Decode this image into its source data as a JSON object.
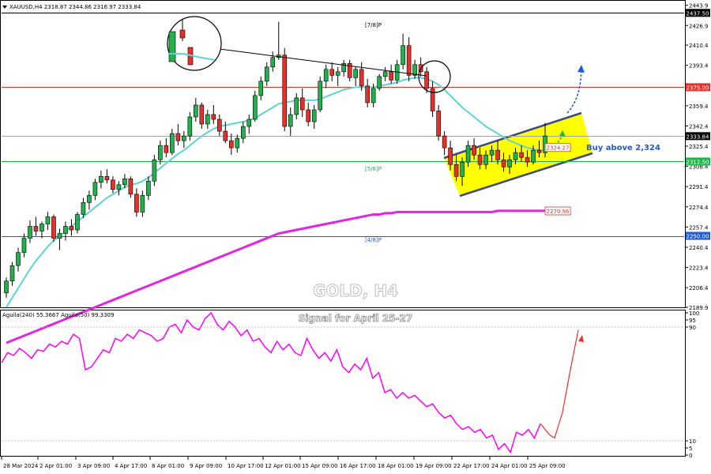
{
  "header": {
    "symbol_info": "XAUUSD,H4  2318.87 2344.86 2316.97 2333.84"
  },
  "indicator_header": "Aguila(240) 55.3667  Aguila(50) 99.3309",
  "watermark": {
    "title": "GOLD, H4",
    "subtitle": "Signal for April 25-27"
  },
  "annotations": {
    "buy_text": "Buy above 2,324",
    "level_7_8": "[7/8]P",
    "level_5_8": "[5/8]P",
    "level_4_8": "[4/8]P"
  },
  "colors": {
    "bull": "#22b14c",
    "bear": "#e8302a",
    "ma_fast": "#5fd3d3",
    "ma_slow": "#e026e0",
    "channel": "#ffff00",
    "buy_text": "#1e5bd7",
    "oscillator": "#ff00ff",
    "projection_red": "#e8302a",
    "projection_green": "#22b14c",
    "projection_blue": "#1e5bd7"
  },
  "chart_data": [
    {
      "type": "candlestick",
      "panel": "price",
      "title": "XAUUSD,H4",
      "x_ticks": [
        "28 Mar 2024",
        "2 Apr 01:00",
        "3 Apr 09:00",
        "4 Apr 17:00",
        "8 Apr 01:00",
        "9 Apr 09:00",
        "10 Apr 17:00",
        "12 Apr 01:00",
        "15 Apr 09:00",
        "16 Apr 17:00",
        "18 Apr 01:00",
        "19 Apr 09:00",
        "22 Apr 17:00",
        "24 Apr 01:00",
        "25 Apr 09:00"
      ],
      "y_ticks": [
        2443.9,
        2426.9,
        2410.4,
        2393.4,
        2376.4,
        2359.4,
        2342.4,
        2325.4,
        2308.4,
        2291.4,
        2274.4,
        2257.4,
        2240.4,
        2223.4,
        2206.4,
        2189.9
      ],
      "ylim": [
        2189.9,
        2447
      ],
      "price_labels": [
        {
          "text": "2437.50",
          "value": 2437.5,
          "color": "#000000"
        },
        {
          "text": "2375.00",
          "value": 2375.0,
          "color": "#e8302a"
        },
        {
          "text": "2333.84",
          "value": 2333.84,
          "color": "#000000"
        },
        {
          "text": "2312.50",
          "value": 2312.5,
          "color": "#22b14c"
        },
        {
          "text": "2250.00",
          "value": 2250.0,
          "color": "#1e5bd7"
        }
      ],
      "horizontal_lines": [
        {
          "name": "[7/8]P",
          "value": 2437.5,
          "color": "#000000"
        },
        {
          "name": "resistance",
          "value": 2375.0,
          "color": "#e8302a"
        },
        {
          "name": "current",
          "value": 2333.84,
          "color": "#a0a0a0"
        },
        {
          "name": "[5/8]P",
          "value": 2312.5,
          "color": "#22b14c"
        },
        {
          "name": "[4/8]P",
          "value": 2250.0,
          "color": "#1e5bd7"
        }
      ],
      "inline_labels": [
        {
          "text": "2324.27",
          "value": 2324.27,
          "color": "#e8302a"
        },
        {
          "text": "2270.96",
          "value": 2270.96,
          "color": "#e8302a"
        }
      ],
      "ohlc": [
        [
          2202,
          2215,
          2198,
          2212
        ],
        [
          2212,
          2228,
          2208,
          2225
        ],
        [
          2225,
          2240,
          2220,
          2236
        ],
        [
          2236,
          2252,
          2232,
          2248
        ],
        [
          2248,
          2263,
          2244,
          2258
        ],
        [
          2258,
          2266,
          2250,
          2254
        ],
        [
          2254,
          2262,
          2248,
          2260
        ],
        [
          2260,
          2270,
          2255,
          2266
        ],
        [
          2266,
          2268,
          2245,
          2248
        ],
        [
          2248,
          2256,
          2238,
          2252
        ],
        [
          2252,
          2262,
          2246,
          2258
        ],
        [
          2258,
          2264,
          2250,
          2255
        ],
        [
          2255,
          2270,
          2252,
          2268
        ],
        [
          2268,
          2282,
          2265,
          2278
        ],
        [
          2278,
          2288,
          2272,
          2284
        ],
        [
          2284,
          2298,
          2280,
          2295
        ],
        [
          2295,
          2305,
          2290,
          2300
        ],
        [
          2300,
          2306,
          2294,
          2297
        ],
        [
          2297,
          2300,
          2286,
          2289
        ],
        [
          2289,
          2296,
          2284,
          2293
        ],
        [
          2293,
          2302,
          2290,
          2298
        ],
        [
          2298,
          2300,
          2282,
          2285
        ],
        [
          2285,
          2290,
          2266,
          2270
        ],
        [
          2270,
          2288,
          2266,
          2284
        ],
        [
          2284,
          2300,
          2280,
          2296
        ],
        [
          2296,
          2318,
          2292,
          2314
        ],
        [
          2314,
          2330,
          2310,
          2326
        ],
        [
          2326,
          2332,
          2316,
          2320
        ],
        [
          2320,
          2340,
          2318,
          2336
        ],
        [
          2336,
          2344,
          2326,
          2330
        ],
        [
          2330,
          2338,
          2324,
          2334
        ],
        [
          2334,
          2354,
          2330,
          2350
        ],
        [
          2350,
          2366,
          2346,
          2360
        ],
        [
          2360,
          2362,
          2340,
          2344
        ],
        [
          2344,
          2356,
          2340,
          2352
        ],
        [
          2352,
          2360,
          2344,
          2348
        ],
        [
          2348,
          2352,
          2334,
          2338
        ],
        [
          2338,
          2346,
          2328,
          2330
        ],
        [
          2330,
          2336,
          2318,
          2324
        ],
        [
          2324,
          2335,
          2320,
          2332
        ],
        [
          2332,
          2346,
          2328,
          2342
        ],
        [
          2342,
          2352,
          2336,
          2348
        ],
        [
          2348,
          2372,
          2346,
          2368
        ],
        [
          2368,
          2384,
          2364,
          2380
        ],
        [
          2380,
          2396,
          2376,
          2392
        ],
        [
          2392,
          2405,
          2388,
          2400
        ],
        [
          2400,
          2430,
          2398,
          2402
        ],
        [
          2402,
          2408,
          2338,
          2342
        ],
        [
          2342,
          2358,
          2334,
          2352
        ],
        [
          2352,
          2370,
          2348,
          2366
        ],
        [
          2366,
          2374,
          2350,
          2356
        ],
        [
          2356,
          2362,
          2342,
          2346
        ],
        [
          2346,
          2360,
          2340,
          2356
        ],
        [
          2356,
          2384,
          2354,
          2380
        ],
        [
          2380,
          2394,
          2374,
          2390
        ],
        [
          2390,
          2396,
          2380,
          2385
        ],
        [
          2385,
          2392,
          2376,
          2388
        ],
        [
          2388,
          2398,
          2384,
          2395
        ],
        [
          2395,
          2398,
          2380,
          2383
        ],
        [
          2383,
          2392,
          2376,
          2390
        ],
        [
          2390,
          2396,
          2372,
          2376
        ],
        [
          2376,
          2382,
          2358,
          2362
        ],
        [
          2362,
          2378,
          2358,
          2374
        ],
        [
          2374,
          2386,
          2372,
          2384
        ],
        [
          2384,
          2392,
          2380,
          2388
        ],
        [
          2388,
          2394,
          2378,
          2381
        ],
        [
          2381,
          2398,
          2378,
          2394
        ],
        [
          2394,
          2420,
          2390,
          2410
        ],
        [
          2410,
          2417,
          2380,
          2385
        ],
        [
          2385,
          2398,
          2382,
          2394
        ],
        [
          2394,
          2400,
          2384,
          2388
        ],
        [
          2388,
          2392,
          2370,
          2374
        ],
        [
          2374,
          2380,
          2350,
          2355
        ],
        [
          2355,
          2360,
          2330,
          2334
        ],
        [
          2334,
          2338,
          2318,
          2324
        ],
        [
          2324,
          2330,
          2305,
          2310
        ],
        [
          2310,
          2318,
          2296,
          2300
        ],
        [
          2300,
          2316,
          2292,
          2312
        ],
        [
          2312,
          2330,
          2308,
          2326
        ],
        [
          2326,
          2332,
          2314,
          2318
        ],
        [
          2318,
          2324,
          2306,
          2310
        ],
        [
          2310,
          2322,
          2306,
          2318
        ],
        [
          2318,
          2326,
          2312,
          2322
        ],
        [
          2322,
          2330,
          2310,
          2314
        ],
        [
          2314,
          2320,
          2304,
          2308
        ],
        [
          2308,
          2318,
          2302,
          2314
        ],
        [
          2314,
          2324,
          2310,
          2320
        ],
        [
          2320,
          2326,
          2312,
          2316
        ],
        [
          2316,
          2322,
          2308,
          2312
        ],
        [
          2312,
          2326,
          2310,
          2322
        ],
        [
          2322,
          2330,
          2316,
          2320
        ],
        [
          2320,
          2345,
          2316,
          2334
        ]
      ],
      "series": [
        {
          "name": "ma_fast",
          "color": "#5fd3d3",
          "values": [
            2190,
            2198,
            2206,
            2214,
            2222,
            2229,
            2235,
            2241,
            2246,
            2250,
            2254,
            2258,
            2262,
            2266,
            2270,
            2274,
            2278,
            2282,
            2285,
            2288,
            2291,
            2293,
            2294,
            2296,
            2299,
            2303,
            2307,
            2311,
            2315,
            2319,
            2322,
            2326,
            2330,
            2334,
            2337,
            2340,
            2342,
            2343,
            2344,
            2345,
            2346,
            2347,
            2349,
            2352,
            2355,
            2358,
            2361,
            2362,
            2363,
            2364,
            2364,
            2364,
            2364,
            2365,
            2367,
            2369,
            2371,
            2373,
            2374,
            2375,
            2375,
            2375,
            2375,
            2376,
            2377,
            2378,
            2379,
            2381,
            2382,
            2383,
            2383,
            2382,
            2380,
            2377,
            2373,
            2368,
            2363,
            2358,
            2354,
            2350,
            2346,
            2342,
            2339,
            2336,
            2333,
            2330,
            2328,
            2326,
            2324,
            2323,
            2322,
            2322
          ]
        },
        {
          "name": "ma_slow",
          "color": "#e026e0",
          "values": [
            2160,
            2162,
            2164,
            2166,
            2168,
            2170,
            2172,
            2174,
            2176,
            2178,
            2180,
            2182,
            2184,
            2186,
            2188,
            2190,
            2192,
            2194,
            2196,
            2198,
            2200,
            2202,
            2204,
            2206,
            2208,
            2210,
            2212,
            2214,
            2216,
            2218,
            2220,
            2222,
            2224,
            2226,
            2228,
            2230,
            2232,
            2234,
            2236,
            2238,
            2240,
            2242,
            2244,
            2246,
            2248,
            2250,
            2252,
            2253,
            2254,
            2255,
            2256,
            2257,
            2258,
            2259,
            2260,
            2261,
            2262,
            2263,
            2264,
            2265,
            2266,
            2267,
            2268,
            2268,
            2269,
            2269,
            2270,
            2270,
            2270,
            2270,
            2270,
            2270,
            2270,
            2270,
            2270,
            2270,
            2270,
            2270,
            2270,
            2270,
            2270,
            2270,
            2270,
            2271,
            2271,
            2271,
            2271,
            2271,
            2271,
            2271,
            2271,
            2271
          ]
        }
      ]
    },
    {
      "type": "line",
      "panel": "oscillator",
      "title": "Aguila(240) 55.3667  Aguila(50) 99.3309",
      "y_ticks": [
        100,
        95,
        90,
        10,
        5,
        0
      ],
      "ylim": [
        0,
        100
      ],
      "series": [
        {
          "name": "Aguila",
          "color": "#ff00ff",
          "values": [
            65,
            72,
            70,
            75,
            72,
            68,
            74,
            73,
            78,
            76,
            80,
            78,
            85,
            82,
            60,
            62,
            68,
            74,
            72,
            82,
            80,
            85,
            82,
            88,
            86,
            84,
            80,
            82,
            90,
            92,
            86,
            95,
            90,
            88,
            96,
            100,
            92,
            88,
            94,
            90,
            84,
            88,
            80,
            82,
            76,
            72,
            80,
            74,
            78,
            72,
            70,
            82,
            74,
            68,
            72,
            66,
            74,
            62,
            58,
            64,
            60,
            68,
            54,
            58,
            44,
            46,
            40,
            44,
            40,
            42,
            38,
            34,
            36,
            30,
            26,
            28,
            22,
            18,
            20,
            16,
            18,
            12,
            14,
            4,
            8,
            2,
            16,
            14,
            18,
            12,
            22
          ]
        },
        {
          "name": "projection",
          "color": "#e8302a",
          "values": [
            22,
            14,
            12,
            30,
            60,
            88
          ]
        }
      ]
    }
  ]
}
